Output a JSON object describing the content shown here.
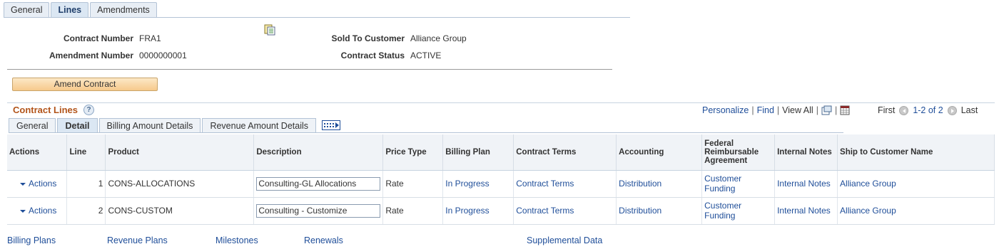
{
  "top_tabs": [
    {
      "label": "General"
    },
    {
      "label": "Lines"
    },
    {
      "label": "Amendments"
    }
  ],
  "header": {
    "contract_number_label": "Contract Number",
    "contract_number": "FRA1",
    "amendment_number_label": "Amendment Number",
    "amendment_number": "0000000001",
    "sold_to_label": "Sold To Customer",
    "sold_to": "Alliance Group",
    "status_label": "Contract Status",
    "status": "ACTIVE",
    "amend_button": "Amend Contract"
  },
  "grid": {
    "title": "Contract Lines",
    "help_icon": "?",
    "nav": {
      "personalize": "Personalize",
      "find": "Find",
      "view_all": "View All",
      "sep": "|"
    },
    "pager": {
      "first": "First",
      "range": "1-2 of 2",
      "last": "Last"
    },
    "tabs": [
      {
        "label": "General"
      },
      {
        "label": "Detail"
      },
      {
        "label": "Billing Amount Details"
      },
      {
        "label": "Revenue Amount Details"
      }
    ],
    "columns": [
      "Actions",
      "Line",
      "Product",
      "Description",
      "Price Type",
      "Billing Plan",
      "Contract Terms",
      "Accounting",
      "Federal Reimbursable Agreement",
      "Internal Notes",
      "Ship to Customer Name"
    ],
    "rows": [
      {
        "actions": "Actions",
        "line": "1",
        "product": "CONS-ALLOCATIONS",
        "description": "Consulting-GL Allocations",
        "price_type": "Rate",
        "billing_plan": "In Progress",
        "contract_terms": "Contract Terms",
        "accounting": "Distribution",
        "federal": "Customer Funding",
        "internal_notes": "Internal Notes",
        "ship_to": "Alliance Group"
      },
      {
        "actions": "Actions",
        "line": "2",
        "product": "CONS-CUSTOM",
        "description": "Consulting - Customize",
        "price_type": "Rate",
        "billing_plan": "In Progress",
        "contract_terms": "Contract Terms",
        "accounting": "Distribution",
        "federal": "Customer Funding",
        "internal_notes": "Internal Notes",
        "ship_to": "Alliance Group"
      }
    ]
  },
  "footer_links": {
    "billing_plans": "Billing Plans",
    "revenue_plans": "Revenue Plans",
    "milestones": "Milestones",
    "renewals": "Renewals",
    "supplemental": "Supplemental Data"
  },
  "colors": {
    "link": "#1f4e99",
    "title": "#b2541a",
    "button_bg": "#f6c98c"
  }
}
